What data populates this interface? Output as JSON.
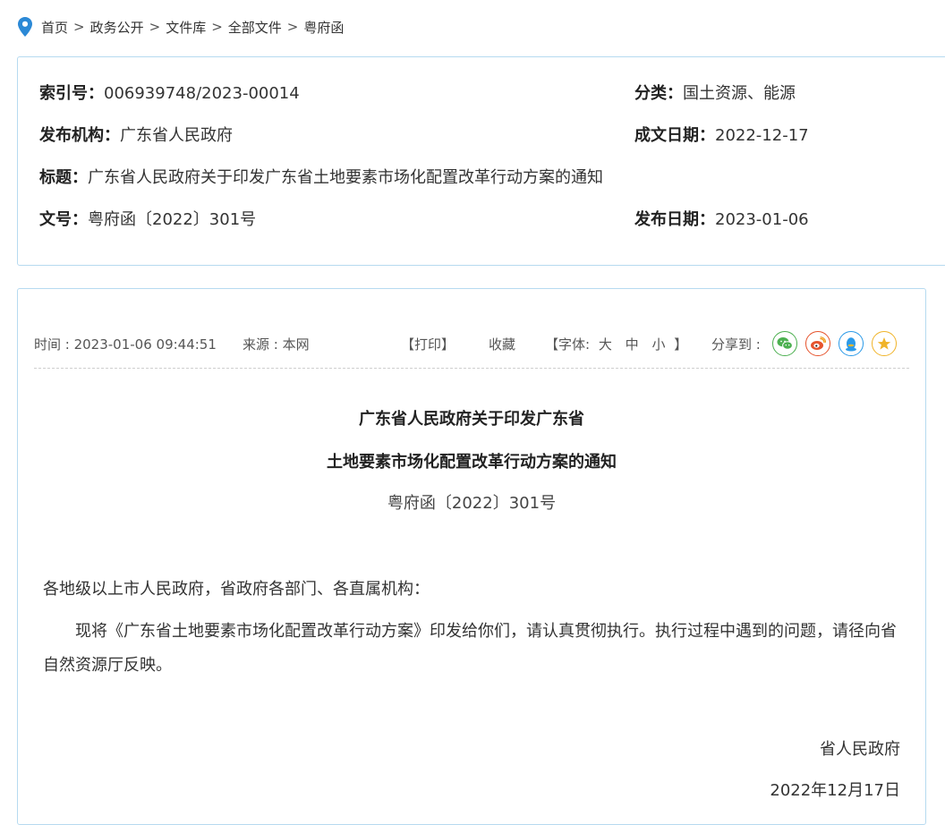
{
  "breadcrumb": {
    "items": [
      "首页",
      "政务公开",
      "文件库",
      "全部文件",
      "粤府函"
    ],
    "separator": ">"
  },
  "meta": {
    "index_no": {
      "label": "索引号：",
      "value": "006939748/2023-00014"
    },
    "category": {
      "label": "分类：",
      "value": "国土资源、能源"
    },
    "publisher": {
      "label": "发布机构：",
      "value": "广东省人民政府"
    },
    "written_date": {
      "label": "成文日期：",
      "value": "2022-12-17"
    },
    "title": {
      "label": "标题：",
      "value": "广东省人民政府关于印发广东省土地要素市场化配置改革行动方案的通知"
    },
    "doc_no": {
      "label": "文号：",
      "value": "粤府函〔2022〕301号"
    },
    "publish_date": {
      "label": "发布日期：",
      "value": "2023-01-06"
    }
  },
  "toolbar": {
    "time": "时间 : 2023-01-06 09:44:51",
    "source": "来源 : 本网",
    "print": "【打印】",
    "favorite": "收藏",
    "font_prefix": "【字体:",
    "font_large": "大",
    "font_medium": "中",
    "font_small": "小",
    "font_suffix": "】",
    "share_label": "分享到 :",
    "share_icons": [
      "wechat-icon",
      "weibo-icon",
      "qq-icon",
      "qzone-star-icon"
    ],
    "share_colors": {
      "wechat": "#4cb050",
      "weibo": "#e6542d",
      "qq": "#2b9ae8",
      "qzone": "#f0b42a"
    }
  },
  "document": {
    "title_line1": "广东省人民政府关于印发广东省",
    "title_line2": "土地要素市场化配置改革行动方案的通知",
    "number": "粤府函〔2022〕301号",
    "salutation": "各地级以上市人民政府，省政府各部门、各直属机构：",
    "paragraph": "现将《广东省土地要素市场化配置改革行动方案》印发给你们，请认真贯彻执行。执行过程中遇到的问题，请径向省自然资源厅反映。",
    "signature_org": "省人民政府",
    "signature_date": "2022年12月17日"
  },
  "colors": {
    "border": "#b6daf0",
    "pin": "#2b89d6"
  }
}
